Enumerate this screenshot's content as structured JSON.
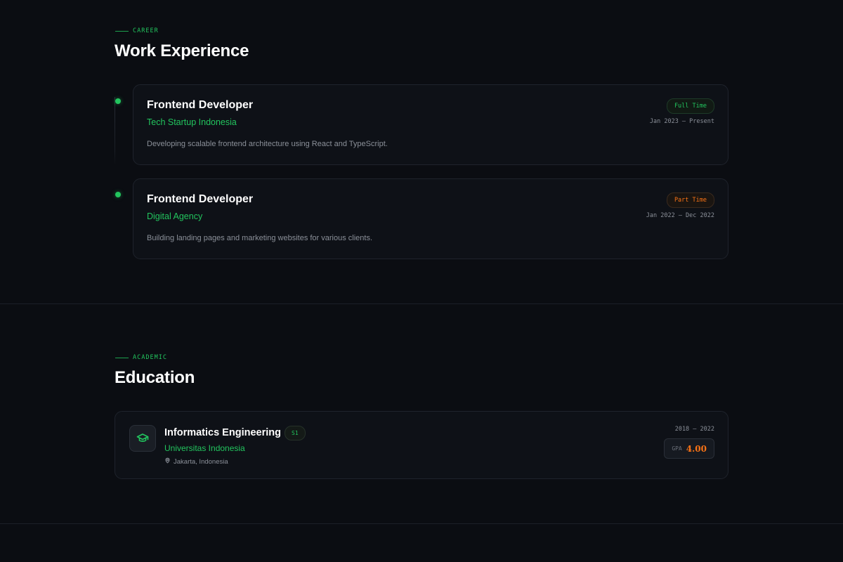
{
  "career": {
    "eyebrow": "CAREER",
    "heading": "Work Experience",
    "jobs": [
      {
        "title": "Frontend Developer",
        "company": "Tech Startup Indonesia",
        "description": "Developing scalable frontend architecture using React and TypeScript.",
        "badge": "Full Time",
        "dates": "Jan 2023 — Present"
      },
      {
        "title": "Frontend Developer",
        "company": "Digital Agency",
        "description": "Building landing pages and marketing websites for various clients.",
        "badge": "Part Time",
        "dates": "Jan 2022 — Dec 2022"
      }
    ]
  },
  "academic": {
    "eyebrow": "ACADEMIC",
    "heading": "Education",
    "education": {
      "icon": "graduation-cap-icon",
      "degree": "Informatics Engineering",
      "level": "S1",
      "school": "Universitas Indonesia",
      "location_icon": "map-pin-icon",
      "location": "Jakarta, Indonesia",
      "years": "2018 — 2022",
      "gpa_label": "GPA",
      "gpa_value": "4.00"
    }
  },
  "colors": {
    "background": "#0b0d12",
    "accent": "#22c55e",
    "highlight": "#f97316",
    "card": "#0e1117"
  }
}
